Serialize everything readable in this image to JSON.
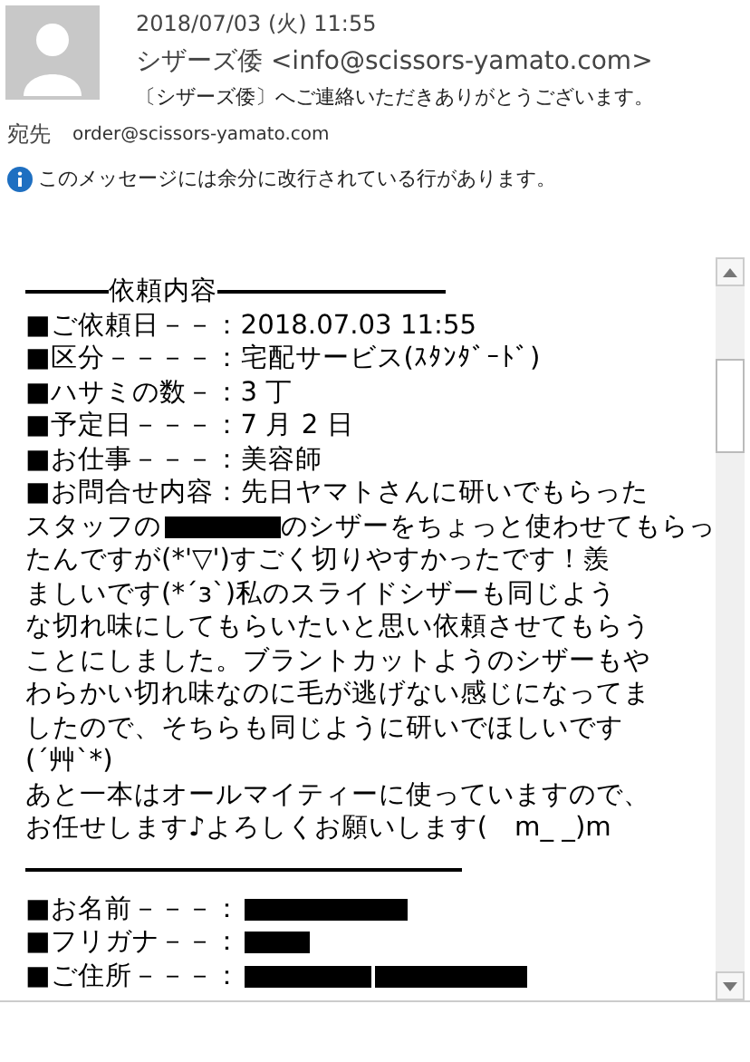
{
  "header": {
    "date": "2018/07/03 (火) 11:55",
    "sender": "シザーズ倭 <info@scissors-yamato.com>",
    "subject": "〔シザーズ倭〕へご連絡いただきありがとうございます。",
    "to_label": "宛先",
    "to": "order@scissors-yamato.com",
    "info": "このメッセージには余分に改行されている行があります。"
  },
  "body": [
    {
      "kind": "heading",
      "text": "依頼内容"
    },
    {
      "kind": "line",
      "segments": [
        {
          "kind": "text",
          "text": "■ご依頼日－－：2018.07.03 11:55"
        }
      ]
    },
    {
      "kind": "line",
      "segments": [
        {
          "kind": "text",
          "text": "■区分－－－－：宅配サービス(ｽﾀﾝﾀﾞｰﾄﾞ)"
        }
      ]
    },
    {
      "kind": "line",
      "segments": [
        {
          "kind": "text",
          "text": "■ハサミの数－：3 丁"
        }
      ]
    },
    {
      "kind": "line",
      "segments": [
        {
          "kind": "text",
          "text": "■予定日－－－：7 月 2 日"
        }
      ]
    },
    {
      "kind": "line",
      "segments": [
        {
          "kind": "text",
          "text": "■お仕事－－－：美容師"
        }
      ]
    },
    {
      "kind": "line",
      "segments": [
        {
          "kind": "text",
          "text": "■お問合せ内容：先日ヤマトさんに研いでもらった"
        }
      ]
    },
    {
      "kind": "line",
      "segments": [
        {
          "kind": "text",
          "text": "スタッフの"
        },
        {
          "kind": "redaction"
        },
        {
          "kind": "text",
          "text": "のシザーをちょっと使わせてもらっ"
        }
      ]
    },
    {
      "kind": "line",
      "segments": [
        {
          "kind": "text",
          "text": "たんですが(*'▽')すごく切りやすかったです！羨"
        }
      ]
    },
    {
      "kind": "line",
      "segments": [
        {
          "kind": "text",
          "text": "ましいです(*´з`)私のスライドシザーも同じよう"
        }
      ]
    },
    {
      "kind": "line",
      "segments": [
        {
          "kind": "text",
          "text": "な切れ味にしてもらいたいと思い依頼させてもらう"
        }
      ]
    },
    {
      "kind": "line",
      "segments": [
        {
          "kind": "text",
          "text": "ことにしました。ブラントカットようのシザーもや"
        }
      ]
    },
    {
      "kind": "line",
      "segments": [
        {
          "kind": "text",
          "text": "わらかい切れ味なのに毛が逃げない感じになってま"
        }
      ]
    },
    {
      "kind": "line",
      "segments": [
        {
          "kind": "text",
          "text": "したので、そちらも同じように研いでほしいです"
        }
      ]
    },
    {
      "kind": "line",
      "segments": [
        {
          "kind": "text",
          "text": "(´艸`*)"
        }
      ]
    },
    {
      "kind": "line",
      "segments": [
        {
          "kind": "text",
          "text": "あと一本はオールマイティーに使っていますので、"
        }
      ]
    },
    {
      "kind": "line",
      "segments": [
        {
          "kind": "text",
          "text": "お任せします♪よろしくお願いします(　m_ _)m"
        }
      ]
    },
    {
      "kind": "rule"
    },
    {
      "kind": "line",
      "segments": [
        {
          "kind": "text",
          "text": "■お名前－－－："
        },
        {
          "kind": "redaction"
        }
      ]
    },
    {
      "kind": "line",
      "segments": [
        {
          "kind": "text",
          "text": "■フリガナ－－："
        },
        {
          "kind": "redaction"
        }
      ]
    },
    {
      "kind": "line",
      "segments": [
        {
          "kind": "text",
          "text": "■ご住所－－－："
        },
        {
          "kind": "redaction"
        },
        {
          "kind": "redaction"
        }
      ]
    }
  ]
}
